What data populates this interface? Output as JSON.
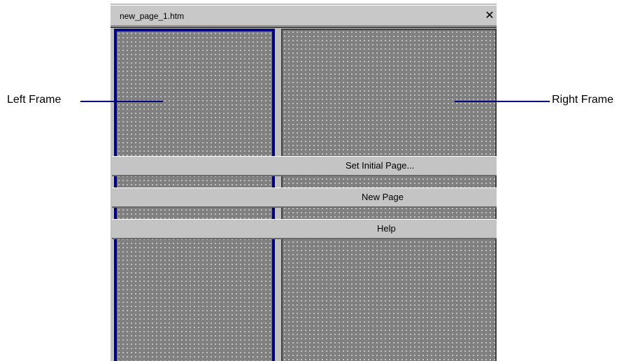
{
  "window": {
    "title": "new_page_1.htm",
    "close_icon": "close-icon"
  },
  "frames": {
    "left": "left-frame",
    "right": "right-frame"
  },
  "menu": {
    "items": [
      {
        "label": "Set Initial Page..."
      },
      {
        "label": "New Page"
      },
      {
        "label": "Help"
      }
    ]
  },
  "callouts": {
    "left": "Left Frame",
    "right": "Right Frame"
  },
  "colors": {
    "frame_border": "#000080",
    "frame_fill": "#808080",
    "chrome": "#c0c0c0"
  }
}
